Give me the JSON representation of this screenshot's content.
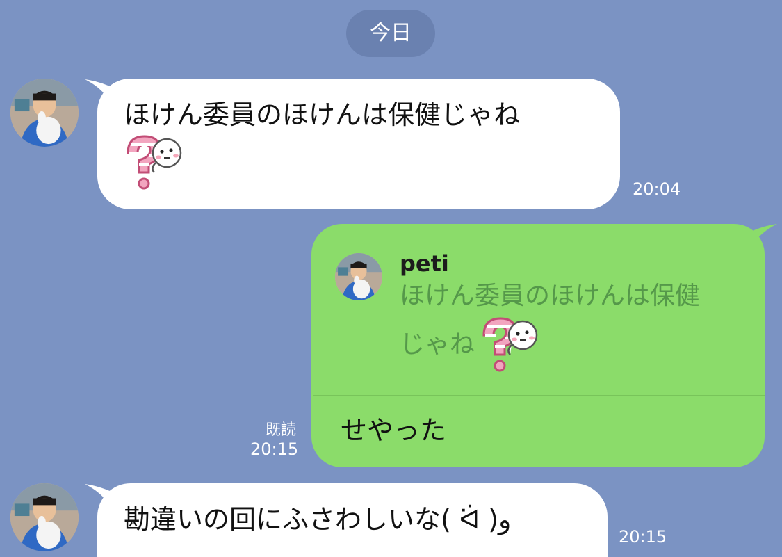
{
  "date_separator": "今日",
  "messages": [
    {
      "line1": "ほけん委員のほけんは保健じゃね",
      "time": "20:04",
      "sticker_icon": "question-mark-smiley-sticker"
    },
    {
      "quote": {
        "name": "peti",
        "line1": "ほけん委員のほけんは保健",
        "line2": "じゃね",
        "sticker_icon": "question-mark-smiley-sticker"
      },
      "text": "せやった",
      "read_label": "既読",
      "time": "20:15"
    },
    {
      "text": "勘違いの回にふさわしいな( ᐛ )و",
      "time": "20:15"
    }
  ],
  "colors": {
    "background": "#7b93c3",
    "incoming_bubble": "#ffffff",
    "outgoing_bubble": "#8bdc6a",
    "date_pill": "#6a81b0"
  }
}
